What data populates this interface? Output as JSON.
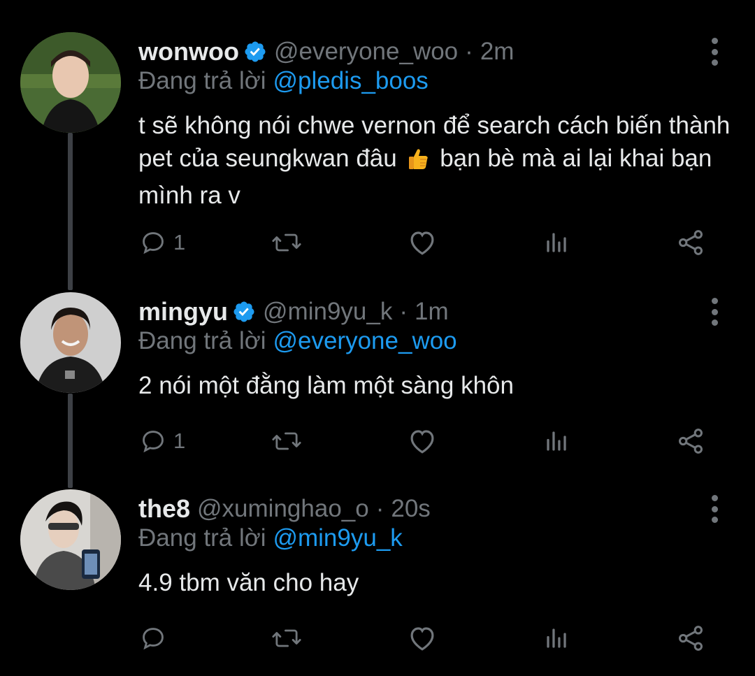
{
  "thread": [
    {
      "display_name": "wonwoo",
      "verified": true,
      "handle": "@everyone_woo",
      "time": "2m",
      "replying_prefix": "Đang trả lời",
      "replying_to": "@pledis_boos",
      "text_part1": "t sẽ không nói chwe vernon để search cách biến thành pet của seungkwan đâu",
      "text_emoji": "thumbs-up",
      "text_part2": "bạn bè mà ai lại khai bạn mình ra v",
      "reply_count": "1",
      "retweet_count": "",
      "like_count": ""
    },
    {
      "display_name": "mingyu",
      "verified": true,
      "handle": "@min9yu_k",
      "time": "1m",
      "replying_prefix": "Đang trả lời",
      "replying_to": "@everyone_woo",
      "text": "2 nói một đằng làm một sàng khôn",
      "reply_count": "1",
      "retweet_count": "",
      "like_count": ""
    },
    {
      "display_name": "the8",
      "verified": false,
      "handle": "@xuminghao_o",
      "time": "20s",
      "replying_prefix": "Đang trả lời",
      "replying_to": "@min9yu_k",
      "text": "4.9 tbm văn cho hay",
      "reply_count": "",
      "retweet_count": "",
      "like_count": ""
    }
  ],
  "separator": "·",
  "icons": {
    "verified": "verified-badge-icon",
    "reply": "reply-icon",
    "retweet": "retweet-icon",
    "like": "heart-icon",
    "views": "analytics-icon",
    "share": "share-icon",
    "more": "more-options-icon"
  },
  "colors": {
    "background": "#000000",
    "text": "#e7e9ea",
    "secondary": "#71767b",
    "accent": "#1d9bf0",
    "thread_line": "#3d4045"
  }
}
